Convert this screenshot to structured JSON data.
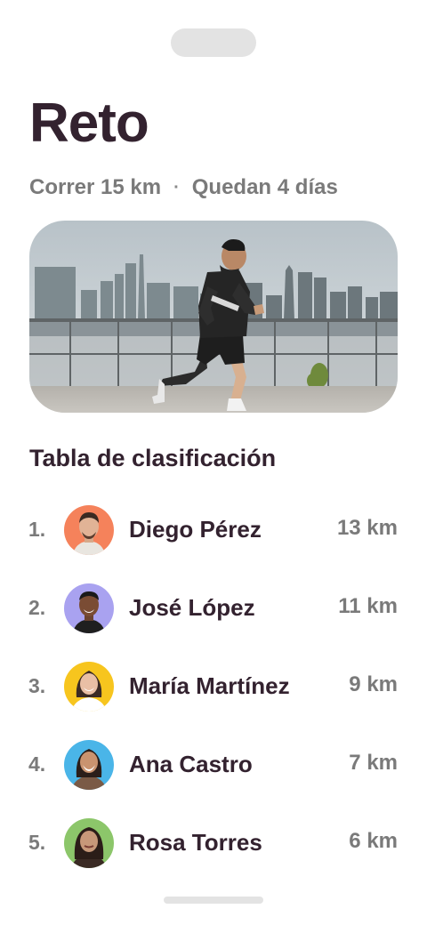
{
  "challenge": {
    "title": "Reto",
    "activity": "Correr 15 km",
    "separator": "·",
    "remaining": "Quedan 4 días",
    "hero_image": "runner-city-skyline-photo"
  },
  "leaderboard": {
    "title": "Tabla de clasificación",
    "entries": [
      {
        "rank": "1.",
        "name": "Diego Pérez",
        "distance": "13 km",
        "avatar_bg": "#f5825b"
      },
      {
        "rank": "2.",
        "name": "José López",
        "distance": "11 km",
        "avatar_bg": "#a9a2f0"
      },
      {
        "rank": "3.",
        "name": "María Martínez",
        "distance": "9 km",
        "avatar_bg": "#f7c51e"
      },
      {
        "rank": "4.",
        "name": "Ana Castro",
        "distance": "7 km",
        "avatar_bg": "#4ab5e8"
      },
      {
        "rank": "5.",
        "name": "Rosa Torres",
        "distance": "6 km",
        "avatar_bg": "#8cc66a"
      }
    ]
  },
  "colors": {
    "heading": "#33222f",
    "muted": "#7a7a7a",
    "background": "#ffffff"
  }
}
